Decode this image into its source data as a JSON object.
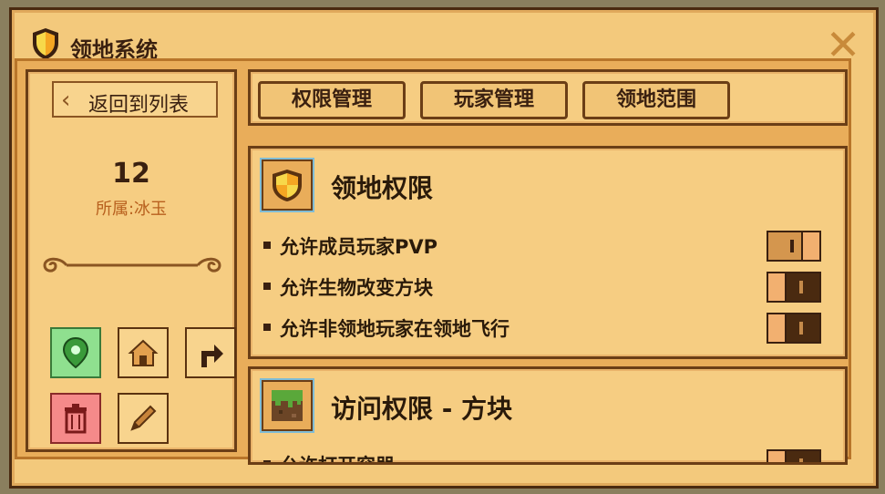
{
  "window": {
    "title": "领地系统",
    "close_label": "✕"
  },
  "sidebar": {
    "back_label": "返回到列表",
    "claim_number": "12",
    "owner": "所属:冰玉"
  },
  "tabs": [
    {
      "label": "权限管理"
    },
    {
      "label": "玩家管理"
    },
    {
      "label": "领地范围"
    }
  ],
  "cards": [
    {
      "title": "领地权限",
      "permissions": [
        {
          "label": "允许成员玩家PVP",
          "enabled": true
        },
        {
          "label": "允许生物改变方块",
          "enabled": false
        },
        {
          "label": "允许非领地玩家在领地飞行",
          "enabled": false
        }
      ]
    },
    {
      "title": "访问权限 - 方块",
      "permissions": [
        {
          "label": "允许打开容器",
          "enabled": false
        }
      ]
    }
  ],
  "colors": {
    "accent": "#f3c97c",
    "border_dark": "#6b3e16",
    "shield_orange": "#f5a623",
    "shield_yellow": "#f7d84a",
    "location_green": "#8fe08f",
    "delete_red": "#f58a8a"
  }
}
